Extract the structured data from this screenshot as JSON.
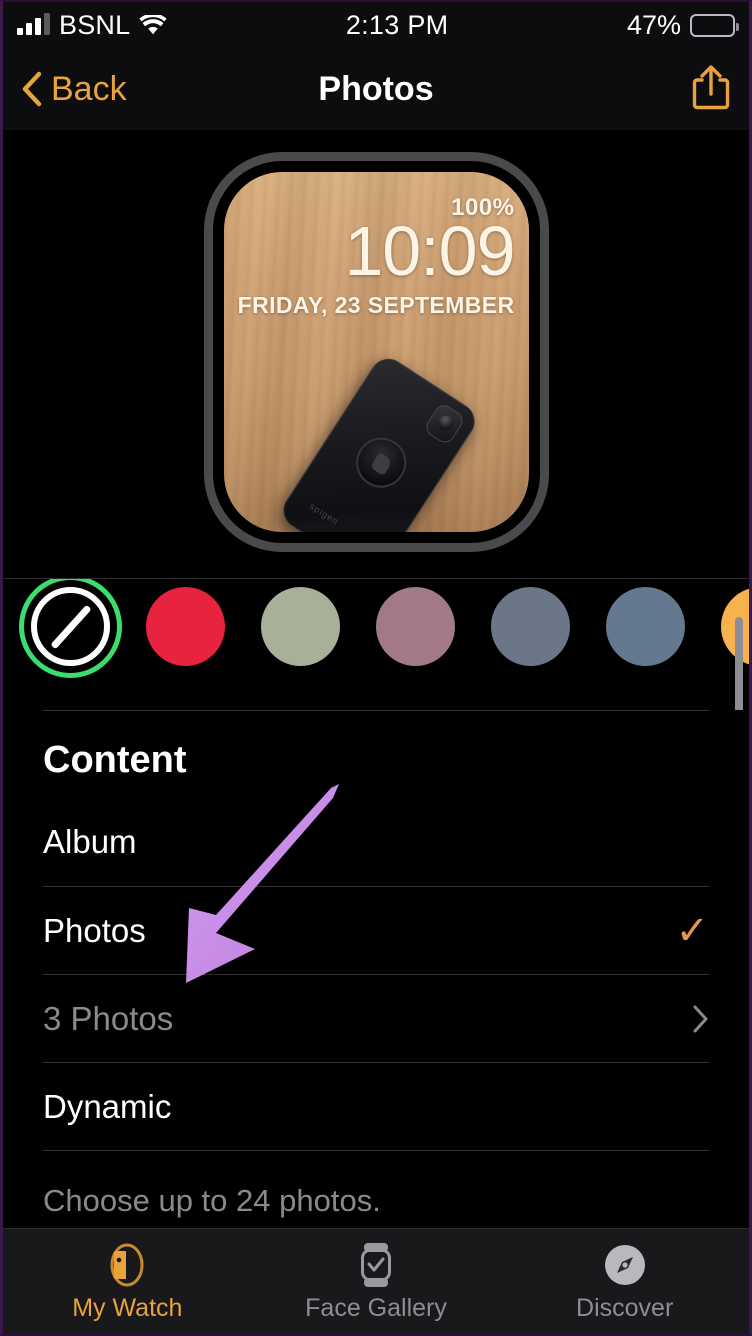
{
  "status_bar": {
    "carrier": "BSNL",
    "time": "2:13 PM",
    "battery_percent": "47%",
    "signal_icon": "cellular-bars-icon",
    "wifi_icon": "wifi-icon",
    "battery_icon": "battery-icon"
  },
  "nav_bar": {
    "back_label": "Back",
    "title": "Photos",
    "share_icon": "share-icon",
    "back_icon": "chevron-left-icon",
    "accent_color": "#e8a33d"
  },
  "watch_preview": {
    "battery": "100%",
    "time": "10:09",
    "date": "FRIDAY, 23 SEPTEMBER",
    "face_type": "photos",
    "photo_description": "black smartphone on wooden surface"
  },
  "color_swatches": {
    "scroll_position": "start",
    "items": [
      {
        "name": "none",
        "color": "#000000",
        "selected": true,
        "ring_color": "#3ddc6e"
      },
      {
        "name": "red",
        "color": "#e8233f",
        "selected": false
      },
      {
        "name": "sage",
        "color": "#a8b09a",
        "selected": false
      },
      {
        "name": "mauve",
        "color": "#a3798a",
        "selected": false
      },
      {
        "name": "slate",
        "color": "#6b7688",
        "selected": false
      },
      {
        "name": "steel-blue",
        "color": "#64788f",
        "selected": false
      },
      {
        "name": "amber",
        "color": "#f7b24e",
        "selected": false
      }
    ]
  },
  "content_section": {
    "header": "Content",
    "rows": [
      {
        "label": "Album",
        "checked": false,
        "chevron": false,
        "dim": false
      },
      {
        "label": "Photos",
        "checked": true,
        "chevron": false,
        "dim": false
      },
      {
        "label": "3 Photos",
        "checked": false,
        "chevron": true,
        "dim": true
      },
      {
        "label": "Dynamic",
        "checked": false,
        "chevron": false,
        "dim": false
      }
    ],
    "footer": "Choose up to 24 photos.",
    "check_glyph": "✓",
    "check_color": "#e8974a"
  },
  "annotation": {
    "type": "arrow",
    "color": "#c78ae4",
    "points_to": "3 Photos"
  },
  "tab_bar": {
    "tabs": [
      {
        "label": "My Watch",
        "icon": "watch-icon",
        "active": true
      },
      {
        "label": "Face Gallery",
        "icon": "watch-check-icon",
        "active": false
      },
      {
        "label": "Discover",
        "icon": "compass-icon",
        "active": false
      }
    ]
  }
}
